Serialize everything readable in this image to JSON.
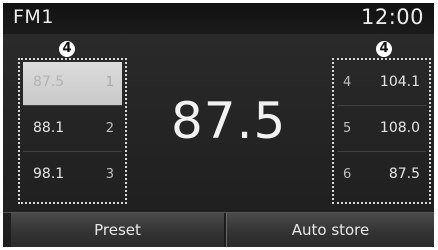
{
  "header": {
    "band": "FM1",
    "time": "12:00"
  },
  "callouts": {
    "left": "4",
    "right": "4"
  },
  "presets_left": [
    {
      "freq": "87.5",
      "num": "1",
      "selected": true
    },
    {
      "freq": "88.1",
      "num": "2",
      "selected": false
    },
    {
      "freq": "98.1",
      "num": "3",
      "selected": false
    }
  ],
  "presets_right": [
    {
      "freq": "104.1",
      "num": "4"
    },
    {
      "freq": "108.0",
      "num": "5"
    },
    {
      "freq": "87.5",
      "num": "6"
    }
  ],
  "current_frequency": "87.5",
  "buttons": {
    "preset": "Preset",
    "auto_store": "Auto store"
  }
}
